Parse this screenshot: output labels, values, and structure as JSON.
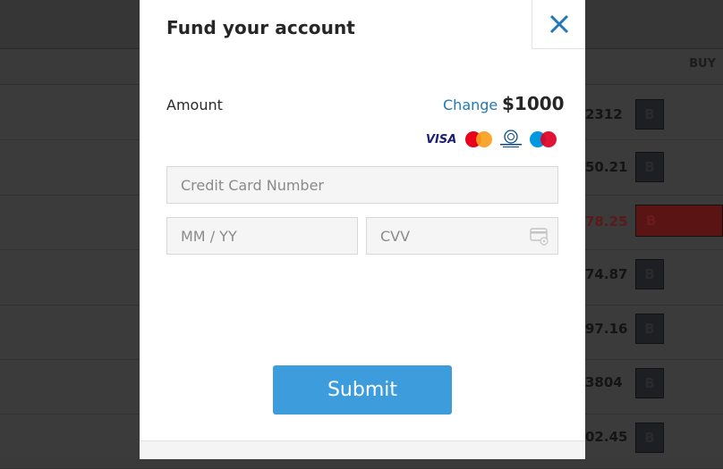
{
  "background": {
    "buy_header": "BUY",
    "rows": [
      {
        "price": "2312",
        "button": "B",
        "highlight": false
      },
      {
        "price": "50.21",
        "button": "B",
        "highlight": false
      },
      {
        "price": "78.25",
        "button": "B",
        "highlight": true
      },
      {
        "price": "74.87",
        "button": "B",
        "highlight": false
      },
      {
        "price": "97.16",
        "button": "B",
        "highlight": false
      },
      {
        "price": "3804",
        "button": "B",
        "highlight": false
      },
      {
        "price": "02.45",
        "button": "B",
        "highlight": false
      }
    ]
  },
  "modal": {
    "title": "Fund your account",
    "close_icon": "close-icon",
    "amount_label": "Amount",
    "change_label": "Change",
    "amount_value": "$1000",
    "card_logos": {
      "visa": "VISA",
      "mastercard": "MasterCard",
      "diners": "Diners Club International",
      "maestro": "Maestro"
    },
    "card_number_placeholder": "Credit Card Number",
    "expiry_placeholder": "MM / YY",
    "cvv_placeholder": "CVV",
    "submit_label": "Submit",
    "accent_color": "#3d9ddc",
    "link_color": "#1f79b8"
  }
}
